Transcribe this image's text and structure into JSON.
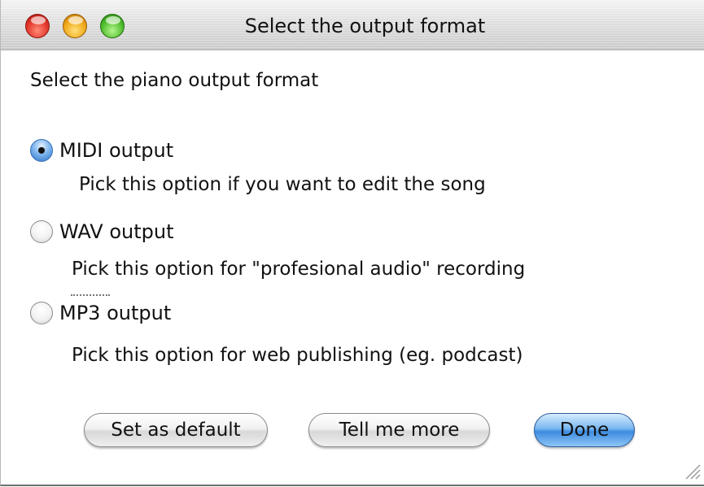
{
  "window": {
    "title": "Select the output format"
  },
  "prompt": "Select the piano output format",
  "options": [
    {
      "label": "MIDI output",
      "description": "Pick this option if you want to edit the song",
      "selected": true
    },
    {
      "label": "WAV output",
      "description": "Pick this option for \"profesional audio\" recording",
      "selected": false
    },
    {
      "label": "MP3 output",
      "description": "Pick this option for web publishing (eg. podcast)",
      "selected": false
    }
  ],
  "buttons": {
    "set_default": "Set as default",
    "tell_more": "Tell me more",
    "done": "Done"
  },
  "colors": {
    "default_button": "#5a9fe6",
    "close": "#e2352a",
    "minimize": "#f0a818",
    "zoom": "#4fbd2d"
  }
}
